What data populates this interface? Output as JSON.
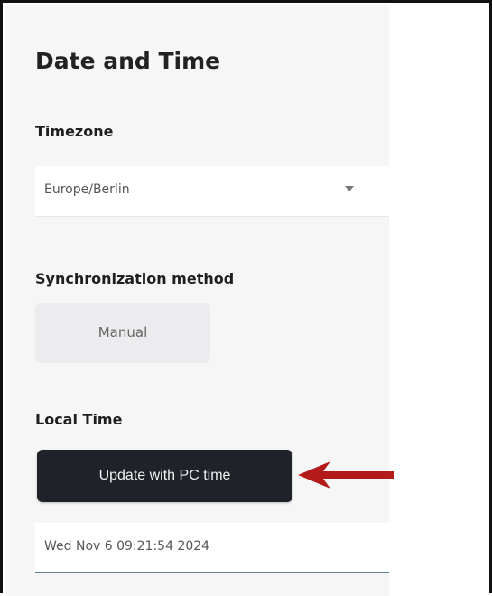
{
  "page": {
    "title": "Date and Time"
  },
  "timezone": {
    "label": "Timezone",
    "selected": "Europe/Berlin"
  },
  "sync": {
    "label": "Synchronization method",
    "option": "Manual"
  },
  "local_time": {
    "label": "Local Time",
    "button_label": "Update with PC time",
    "value": "Wed Nov 6 09:21:54 2024"
  },
  "annotation": {
    "arrow_color": "#b31b1b"
  }
}
